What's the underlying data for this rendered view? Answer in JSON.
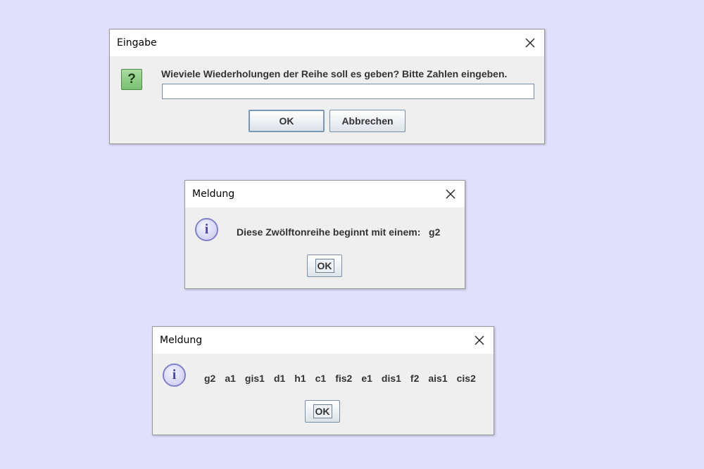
{
  "dialogs": {
    "input": {
      "title": "Eingabe",
      "message": "Wieviele Wiederholungen der Reihe soll es geben? Bitte Zahlen eingeben.",
      "icon": "question-icon",
      "value": "",
      "ok_label": "OK",
      "cancel_label": "Abbrechen"
    },
    "message1": {
      "title": "Meldung",
      "icon": "info-icon",
      "message": "Diese Zwölftonreihe beginnt mit einem:   g2",
      "ok_label": "OK"
    },
    "message2": {
      "title": "Meldung",
      "icon": "info-icon",
      "notes": [
        "g2",
        "a1",
        "gis1",
        "d1",
        "h1",
        "c1",
        "fis2",
        "e1",
        "dis1",
        "f2",
        "ais1",
        "cis2"
      ],
      "ok_label": "OK"
    }
  },
  "colors": {
    "desktop": "#e0e0fc",
    "dialog_bg": "#efefef",
    "titlebar_bg": "#ffffff"
  }
}
